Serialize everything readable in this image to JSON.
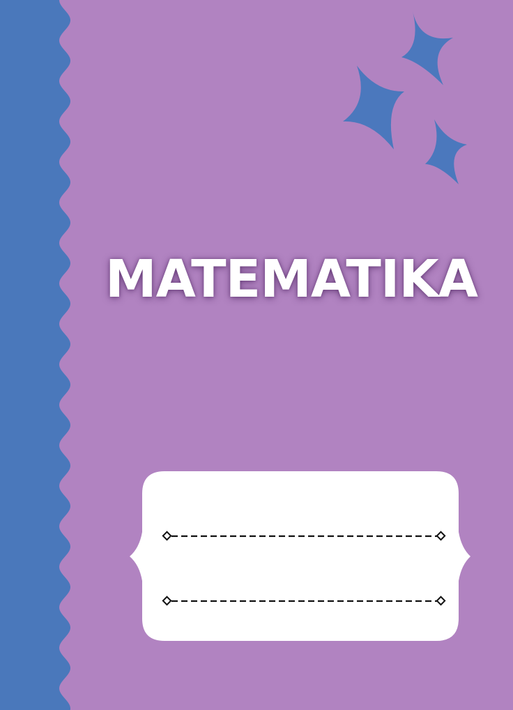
{
  "cover": {
    "title": "MATEMATIKA"
  },
  "colors": {
    "background_purple": "#b183c1",
    "spine_blue": "#4a78bb",
    "star_blue": "#4b78bd",
    "label_white": "#ffffff",
    "line_black": "#111111"
  },
  "icons": {
    "decoration": [
      "sparkle-star-icon",
      "sparkle-star-icon",
      "sparkle-star-icon"
    ]
  }
}
